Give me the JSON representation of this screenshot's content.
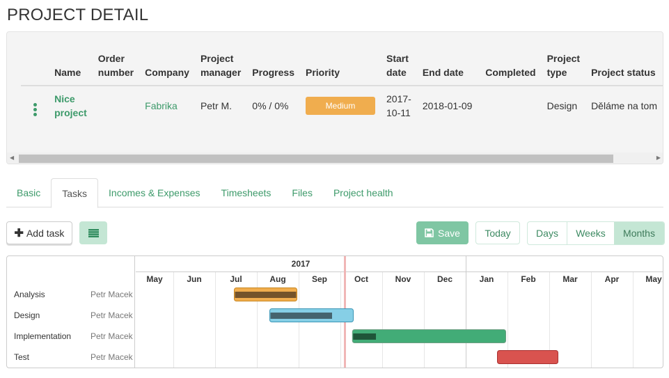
{
  "page": {
    "title": "PROJECT DETAIL"
  },
  "project_table": {
    "headers": [
      {
        "line1": "",
        "line2": "Name"
      },
      {
        "line1": "Order",
        "line2": "number"
      },
      {
        "line1": "",
        "line2": "Company"
      },
      {
        "line1": "Project",
        "line2": "manager"
      },
      {
        "line1": "",
        "line2": "Progress"
      },
      {
        "line1": "",
        "line2": "Priority"
      },
      {
        "line1": "Start",
        "line2": "date"
      },
      {
        "line1": "",
        "line2": "End date"
      },
      {
        "line1": "",
        "line2": "Completed"
      },
      {
        "line1": "Project",
        "line2": "type"
      },
      {
        "line1": "",
        "line2": "Project status"
      }
    ],
    "row": {
      "name_line1": "Nice",
      "name_line2": "project",
      "order_number": "",
      "company": "Fabrika",
      "manager": "Petr M.",
      "progress": "0% / 0%",
      "priority": "Medium",
      "start_line1": "2017-",
      "start_line2": "10-11",
      "end_date": "2018-01-09",
      "completed": "",
      "type": "Design",
      "status": "Děláme na tom"
    }
  },
  "tabs": [
    {
      "label": "Basic",
      "active": false
    },
    {
      "label": "Tasks",
      "active": true
    },
    {
      "label": "Incomes & Expenses",
      "active": false
    },
    {
      "label": "Timesheets",
      "active": false
    },
    {
      "label": "Files",
      "active": false
    },
    {
      "label": "Project health",
      "active": false
    }
  ],
  "toolbar": {
    "add_task": "Add task",
    "save": "Save",
    "today": "Today",
    "views": [
      "Days",
      "Weeks",
      "Months"
    ],
    "active_view": "Months"
  },
  "colors": {
    "accent": "#3d9a6a",
    "priority_medium": "#f0ad4e",
    "today_line": "#f0b6b6"
  },
  "chart_data": {
    "type": "gantt",
    "years": [
      {
        "label": "2017",
        "months": 8
      },
      {
        "label": "",
        "months": 5
      }
    ],
    "months": [
      "May",
      "Jun",
      "Jul",
      "Aug",
      "Sep",
      "Oct",
      "Nov",
      "Dec",
      "Jan",
      "Feb",
      "Mar",
      "Apr",
      "May"
    ],
    "today": 5.1,
    "tasks": [
      {
        "name": "Analysis",
        "person": "Petr Macek",
        "start": 2.45,
        "end": 3.95,
        "progress": 1.0,
        "color": "#f0ad4e",
        "border": "#c8861f",
        "progress_color": "#74532a"
      },
      {
        "name": "Design",
        "person": "Petr Macek",
        "start": 3.3,
        "end": 5.3,
        "progress": 0.75,
        "color": "#86cfe6",
        "border": "#3a96b6",
        "progress_color": "#45646f"
      },
      {
        "name": "Implementation",
        "person": "Petr Macek",
        "start": 5.28,
        "end": 8.95,
        "progress": 0.15,
        "color": "#42ac77",
        "border": "#6e9e82",
        "progress_color": "#1f5539"
      },
      {
        "name": "Test",
        "person": "Petr Macek",
        "start": 8.75,
        "end": 10.2,
        "progress": 0,
        "color": "#d9534f",
        "border": "#a83030",
        "progress_color": "#a83030"
      }
    ]
  }
}
